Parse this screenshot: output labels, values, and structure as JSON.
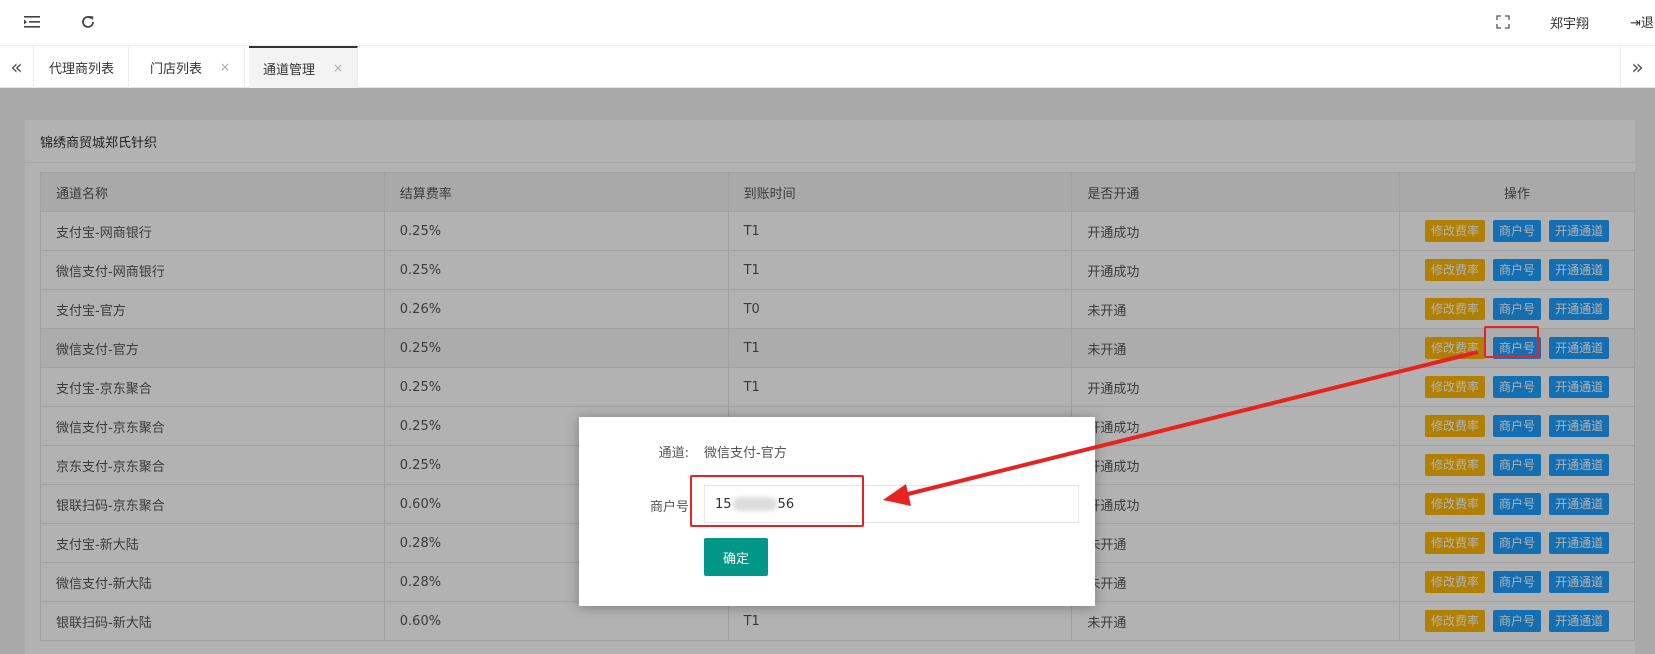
{
  "header": {
    "user_name": "郑宇翔",
    "logout_label": "退"
  },
  "tabs": [
    {
      "label": "代理商列表"
    },
    {
      "label": "门店列表",
      "close": "×"
    },
    {
      "label": "通道管理",
      "close": "×"
    }
  ],
  "panel": {
    "title": "锦绣商贸城郑氏针织"
  },
  "table": {
    "columns": [
      "通道名称",
      "结算费率",
      "到账时间",
      "是否开通",
      "操作"
    ],
    "rows": [
      [
        "支付宝-网商银行",
        "0.25%",
        "T1",
        "开通成功"
      ],
      [
        "微信支付-网商银行",
        "0.25%",
        "T1",
        "开通成功"
      ],
      [
        "支付宝-官方",
        "0.26%",
        "T0",
        "未开通"
      ],
      [
        "微信支付-官方",
        "0.25%",
        "T1",
        "未开通"
      ],
      [
        "支付宝-京东聚合",
        "0.25%",
        "T1",
        "开通成功"
      ],
      [
        "微信支付-京东聚合",
        "0.25%",
        "",
        "开通成功"
      ],
      [
        "京东支付-京东聚合",
        "0.25%",
        "",
        "开通成功"
      ],
      [
        "银联扫码-京东聚合",
        "0.60%",
        "",
        "开通成功"
      ],
      [
        "支付宝-新大陆",
        "0.28%",
        "",
        "未开通"
      ],
      [
        "微信支付-新大陆",
        "0.28%",
        "",
        "未开通"
      ],
      [
        "银联扫码-新大陆",
        "0.60%",
        "T1",
        "未开通"
      ]
    ],
    "actions": {
      "modify_rate": "修改费率",
      "merchant_no": "商户号",
      "open_channel": "开通通道"
    }
  },
  "dialog": {
    "channel_label": "通道:",
    "channel_value": "微信支付-官方",
    "merchant_label": "商户号",
    "merchant_prefix": "15",
    "merchant_suffix": "56",
    "confirm_label": "确定"
  },
  "colors": {
    "modify_rate_button": "#FFB800",
    "blue_button": "#1E9FFF",
    "confirm_button": "#009688",
    "annotation_red": "#e62222"
  }
}
